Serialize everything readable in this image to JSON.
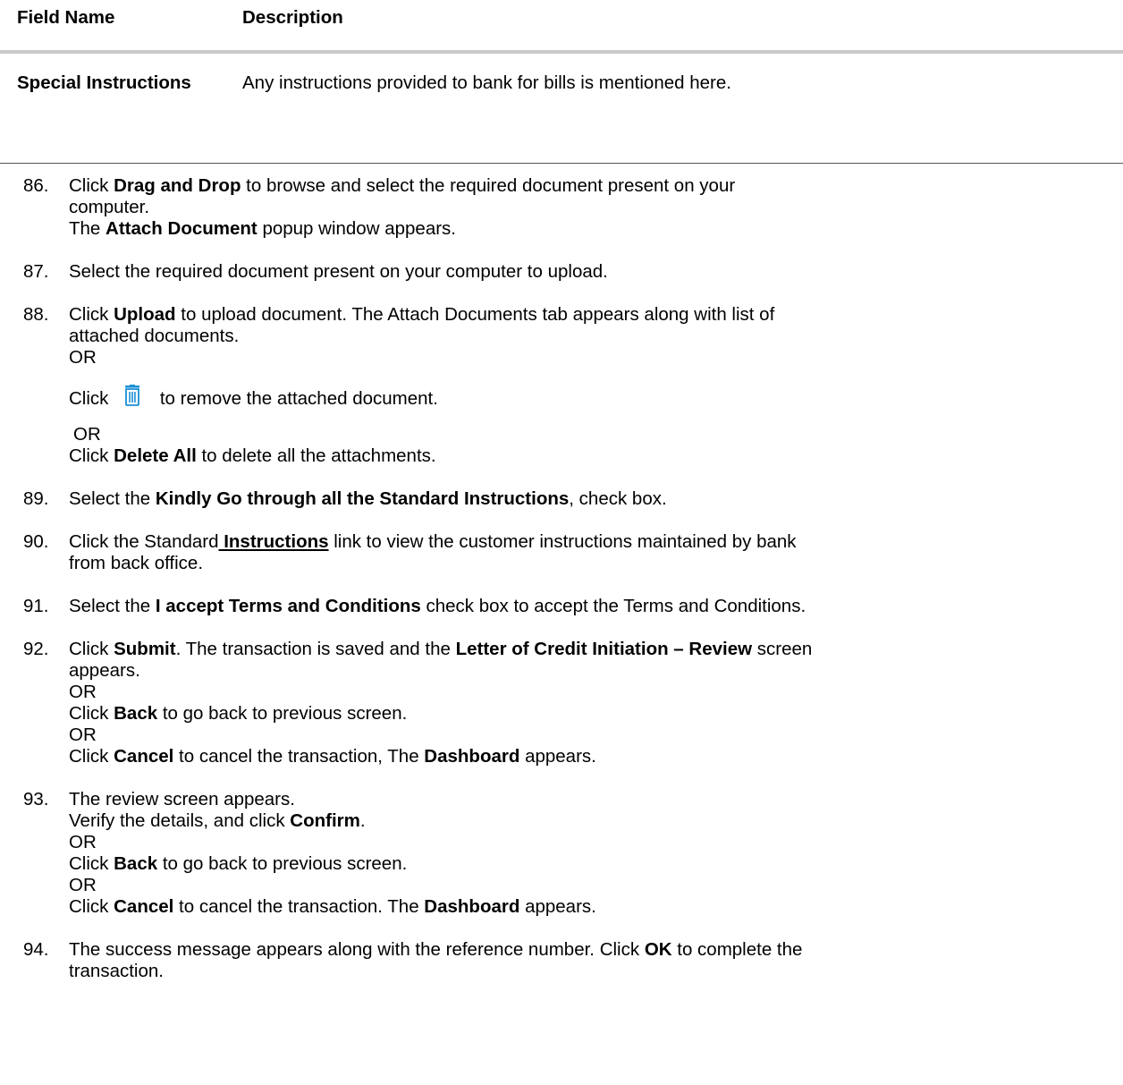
{
  "table": {
    "headers": {
      "field": "Field Name",
      "description": "Description"
    },
    "rows": [
      {
        "field": "Special Instructions",
        "description": "Any instructions provided to bank for bills is mentioned here."
      }
    ]
  },
  "steps": {
    "s86": {
      "num": "86.",
      "a": "Click ",
      "b_drag": "Drag and Drop",
      "c": " to browse and select the required document present on your",
      "d": "computer.",
      "e": "The ",
      "b_attach": "Attach Document",
      "f": " popup window appears."
    },
    "s87": {
      "num": "87.",
      "text": "Select the required document present on your computer to upload."
    },
    "s88": {
      "num": "88.",
      "a": "Click ",
      "b_upload": "Upload",
      "c": " to upload document. The Attach Documents tab appears along with list of",
      "d": "attached documents.",
      "or1": "OR",
      "click1": "Click",
      "icon": "trash-icon",
      "remove": "to remove the attached document.",
      "or2": "OR",
      "click2": "Click ",
      "b_delete": "Delete All",
      "delete_rest": " to delete all the attachments."
    },
    "s89": {
      "num": "89.",
      "a": "Select the ",
      "b_kindly": "Kindly Go through all the Standard Instructions",
      "c": ", check box."
    },
    "s90": {
      "num": "90.",
      "a": "Click the Standard",
      "link": " Instructions",
      "c": " link to view the customer instructions maintained by bank",
      "d": "from back office."
    },
    "s91": {
      "num": "91.",
      "a": "Select the ",
      "b_accept": "I accept Terms and Conditions",
      "c": " check box to accept the Terms and Conditions."
    },
    "s92": {
      "num": "92.",
      "a": "Click ",
      "b_submit": "Submit",
      "c": ". The transaction is saved and the ",
      "b_review": "Letter of Credit Initiation – Review",
      "d": " screen",
      "e": "appears.",
      "or1": "OR",
      "click_back": "Click ",
      "b_back": "Back",
      "back_rest": " to go back to previous screen.",
      "or2": "OR",
      "click_cancel": "Click ",
      "b_cancel": "Cancel",
      "cancel_mid": " to cancel the transaction, The ",
      "b_dashboard": "Dashboard",
      "cancel_end": " appears."
    },
    "s93": {
      "num": "93.",
      "a": "The review screen appears.",
      "b": "Verify the details, and click ",
      "b_confirm": "Confirm",
      "c": ".",
      "or1": "OR",
      "click_back": "Click ",
      "b_back": "Back",
      "back_rest": " to go back to previous screen.",
      "or2": "OR",
      "click_cancel": "Click ",
      "b_cancel": "Cancel",
      "cancel_mid": " to cancel the transaction. The ",
      "b_dashboard": "Dashboard",
      "cancel_end": " appears."
    },
    "s94": {
      "num": "94.",
      "a": "The success message appears along with the reference number. Click ",
      "b_ok": "OK",
      "c": " to complete the",
      "d": "transaction."
    }
  },
  "colors": {
    "icon_blue": "#1a8fd6",
    "header_rule": "#c8c8c8",
    "row_rule": "#555555"
  }
}
